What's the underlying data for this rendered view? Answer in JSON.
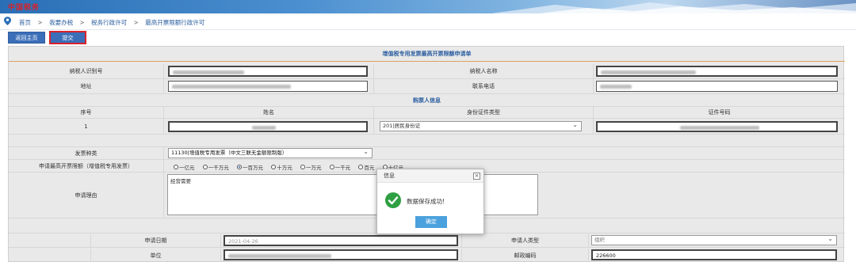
{
  "banner": {
    "logo": "中国税务"
  },
  "breadcrumb": [
    "首页",
    "我要办税",
    "税务行政许可",
    "最高开票限额行政许可"
  ],
  "toolbar": {
    "home_label": "返回主页",
    "submit_label": "提交"
  },
  "form": {
    "title": "增值税专用发票最高开票限额申请单",
    "taxpayer_id_label": "纳税人识别号",
    "taxpayer_name_label": "纳税人名称",
    "address_label": "地址",
    "phone_label": "联系电话",
    "buyer_section_title": "购票人信息",
    "buyer_headers": [
      "序号",
      "姓名",
      "身份证件类型",
      "证件号码"
    ],
    "buyer_row": {
      "index": "1",
      "id_type": "201|居民身份证"
    },
    "invoice_type_label": "发票种类",
    "invoice_type_value": "11130|增值税专用发票（中文三联无金额限制版）",
    "limit_label": "申请最高开票限额（增值税专用发票）",
    "limit_options": [
      "一亿元",
      "一千万元",
      "一百万元",
      "十万元",
      "一万元",
      "一千元",
      "百元",
      "十亿元"
    ],
    "limit_selected": "一百万元",
    "reason_label": "申请理由",
    "reason_value": "经营需要",
    "apply_date_label": "申请日期",
    "apply_date_value": "2021-04-26",
    "applicant_type_label": "申请人类型",
    "applicant_type_value": "组织",
    "unit_label": "单位",
    "postcode_label": "邮政编码",
    "postcode_value": "226600"
  },
  "dialog": {
    "title": "信息",
    "message": "数据保存成功!",
    "ok_label": "确定"
  },
  "colors": {
    "accent": "#3b6eb8",
    "header_text": "#2a5d9f",
    "ok_button": "#4aa1dd",
    "success": "#2ea043",
    "highlight": "#d9222a"
  }
}
